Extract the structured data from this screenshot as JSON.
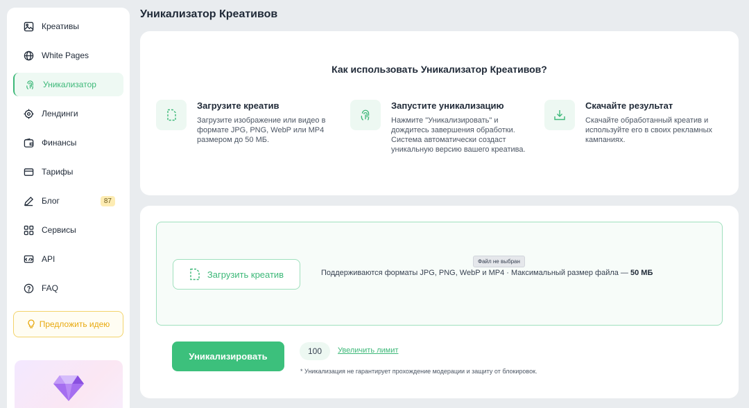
{
  "page_title": "Уникализатор Креативов",
  "sidebar": {
    "items": [
      {
        "label": "Креативы",
        "icon": "image-icon"
      },
      {
        "label": "White Pages",
        "icon": "globe-icon"
      },
      {
        "label": "Уникализатор",
        "icon": "fingerprint-icon",
        "active": true
      },
      {
        "label": "Лендинги",
        "icon": "target-icon"
      },
      {
        "label": "Финансы",
        "icon": "wallet-icon"
      },
      {
        "label": "Тарифы",
        "icon": "card-icon"
      },
      {
        "label": "Блог",
        "icon": "pen-icon",
        "badge": "87"
      },
      {
        "label": "Сервисы",
        "icon": "grid-icon"
      },
      {
        "label": "API",
        "icon": "api-icon"
      },
      {
        "label": "FAQ",
        "icon": "help-icon"
      }
    ],
    "idea_button": "Предложить идею"
  },
  "how_to": {
    "title": "Как использовать Уникализатор Креативов?",
    "steps": [
      {
        "title": "Загрузите креатив",
        "desc": "Загрузите изображение или видео в формате JPG, PNG, WebP или MP4 размером до 50 МБ."
      },
      {
        "title": "Запустите уникализацию",
        "desc": "Нажмите \"Уникализировать\" и дождитесь завершения обработки. Система автоматически создаст уникальную версию вашего креатива."
      },
      {
        "title": "Скачайте результат",
        "desc": "Скачайте обработанный креатив и используйте его в своих рекламных кампаниях."
      }
    ]
  },
  "upload": {
    "file_status": "Файл не выбран",
    "button_label": "Загрузить креатив",
    "formats_text": "Поддерживаются форматы JPG, PNG, WebP и MP4 · Максимальный размер файла —",
    "max_size": "50 МБ"
  },
  "actions": {
    "uniquify_label": "Уникализировать",
    "limit_value": "100",
    "increase_limit_label": "Увеличить лимит",
    "disclaimer": "* Уникализация не гарантирует прохождение модерации и защиту от блокировок."
  },
  "colors": {
    "accent": "#3cc07c",
    "accent_text": "#3cb878",
    "badge_bg": "#fdecb3",
    "idea_border": "#f3d36b",
    "idea_text": "#e8a90e"
  }
}
